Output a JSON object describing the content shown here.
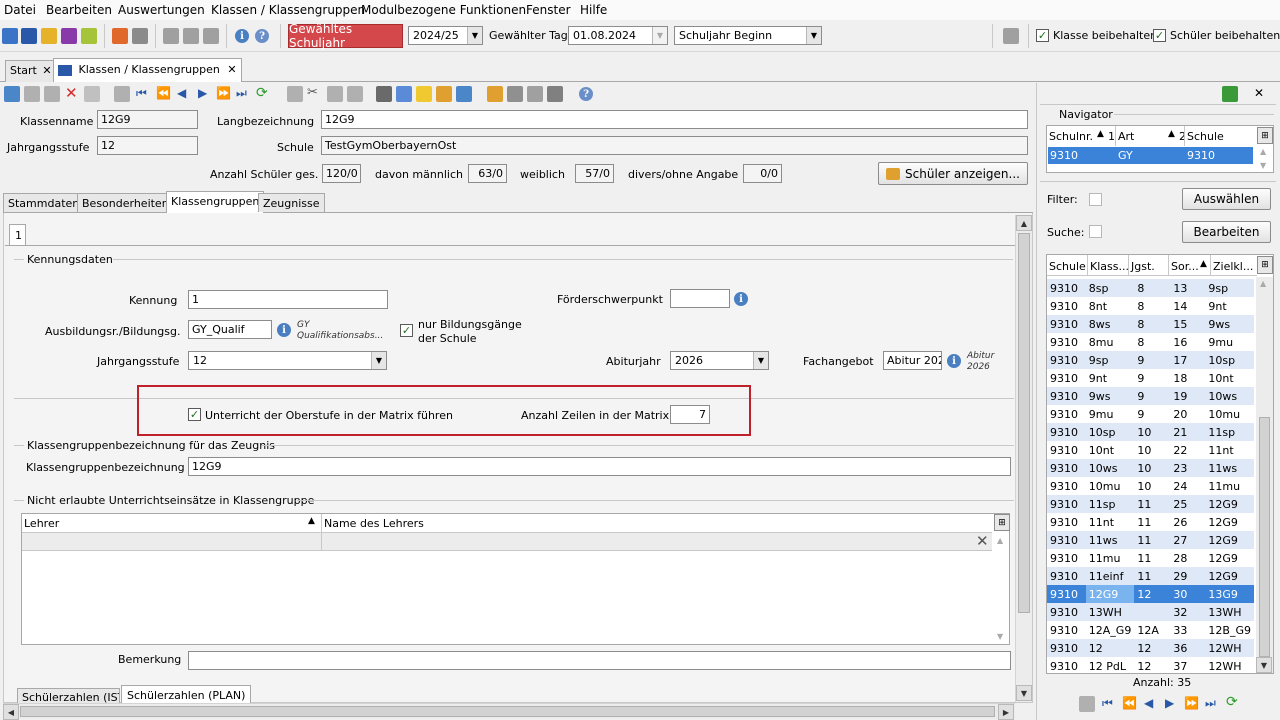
{
  "menu": [
    "Datei",
    "Bearbeiten",
    "Auswertungen",
    "Klassen / Klassengruppen",
    "Modulbezogene Funktionen",
    "Fenster",
    "Hilfe"
  ],
  "toolbar": {
    "schuljahr_button": "Gewähltes Schuljahr",
    "schuljahr_value": "2024/25",
    "tag_label": "Gewählter Tag",
    "tag_value": "01.08.2024",
    "period_value": "Schuljahr Beginn",
    "klasse_beibehalten": "Klasse beibehalten",
    "schueler_beibehalten": "Schüler beibehalten"
  },
  "doc_tabs": {
    "start": "Start",
    "klassen": "Klassen / Klassengruppen"
  },
  "header": {
    "klassenname_label": "Klassenname",
    "klassenname": "12G9",
    "langbezeichnung_label": "Langbezeichnung",
    "langbezeichnung": "12G9",
    "jahrgangsstufe_label": "Jahrgangsstufe",
    "jahrgangsstufe": "12",
    "schule_label": "Schule",
    "schule": "TestGymOberbayernOst",
    "anzahl_label": "Anzahl Schüler ges.",
    "anzahl": "120/0",
    "maennlich_label": "davon männlich",
    "maennlich": "63/0",
    "weiblich_label": "weiblich",
    "weiblich": "57/0",
    "divers_label": "divers/ohne Angabe",
    "divers": "0/0",
    "schueler_anzeigen": "Schüler anzeigen..."
  },
  "form_tabs": [
    "Stammdaten",
    "Besonderheiten",
    "Klassengruppen",
    "Zeugnisse"
  ],
  "subtab": "1",
  "kennung": {
    "section": "Kennungsdaten",
    "kennung_label": "Kennung",
    "kennung": "1",
    "foerder_label": "Förderschwerpunkt",
    "foerder": "",
    "ausbildung_label": "Ausbildungsr./Bildungsg.",
    "ausbildung": "GY_Qualif",
    "ausbildung_hint_1": "GY",
    "ausbildung_hint_2": "Qualifikationsabs...",
    "nur_bildung_1": "nur Bildungsgänge",
    "nur_bildung_2": "der Schule",
    "jahrgang_label": "Jahrgangsstufe",
    "jahrgang": "12",
    "abitur_label": "Abiturjahr",
    "abitur": "2026",
    "fachangebot_label": "Fachangebot",
    "fachangebot": "Abitur 202",
    "fach_hint_1": "Abitur",
    "fach_hint_2": "2026",
    "matrix_label": "Unterricht der Oberstufe in der Matrix führen",
    "zeilen_label": "Anzahl Zeilen in der Matrix",
    "zeilen": "7"
  },
  "zeugnis": {
    "section": "Klassengruppenbezeichnung für das Zeugnis",
    "label": "Klassengruppenbezeichnung",
    "value": "12G9"
  },
  "nicht_erlaubt": {
    "section": "Nicht erlaubte Unterrichtseinsätze in Klassengruppe",
    "col1": "Lehrer",
    "col2": "Name des Lehrers"
  },
  "bemerkung_label": "Bemerkung",
  "bottom_tabs": [
    "Schülerzahlen (IST)",
    "Schülerzahlen (PLAN)"
  ],
  "navigator": {
    "title": "Navigator",
    "cols": [
      "Schulnr.",
      "Art",
      "Schule"
    ],
    "sort_marks": [
      "1",
      "2"
    ],
    "row": [
      "9310",
      "GY",
      "9310"
    ],
    "filter_label": "Filter:",
    "suche_label": "Suche:",
    "auswaehlen": "Auswählen",
    "bearbeiten": "Bearbeiten",
    "list_cols": [
      "Schule",
      "Klass...",
      "Jgst.",
      "Sor...",
      "Zielkl..."
    ],
    "rows": [
      [
        "9310",
        "8sp",
        "8",
        "13",
        "9sp"
      ],
      [
        "9310",
        "8nt",
        "8",
        "14",
        "9nt"
      ],
      [
        "9310",
        "8ws",
        "8",
        "15",
        "9ws"
      ],
      [
        "9310",
        "8mu",
        "8",
        "16",
        "9mu"
      ],
      [
        "9310",
        "9sp",
        "9",
        "17",
        "10sp"
      ],
      [
        "9310",
        "9nt",
        "9",
        "18",
        "10nt"
      ],
      [
        "9310",
        "9ws",
        "9",
        "19",
        "10ws"
      ],
      [
        "9310",
        "9mu",
        "9",
        "20",
        "10mu"
      ],
      [
        "9310",
        "10sp",
        "10",
        "21",
        "11sp"
      ],
      [
        "9310",
        "10nt",
        "10",
        "22",
        "11nt"
      ],
      [
        "9310",
        "10ws",
        "10",
        "23",
        "11ws"
      ],
      [
        "9310",
        "10mu",
        "10",
        "24",
        "11mu"
      ],
      [
        "9310",
        "11sp",
        "11",
        "25",
        "12G9"
      ],
      [
        "9310",
        "11nt",
        "11",
        "26",
        "12G9"
      ],
      [
        "9310",
        "11ws",
        "11",
        "27",
        "12G9"
      ],
      [
        "9310",
        "11mu",
        "11",
        "28",
        "12G9"
      ],
      [
        "9310",
        "11einf",
        "11",
        "29",
        "12G9"
      ],
      [
        "9310",
        "12G9",
        "12",
        "30",
        "13G9"
      ],
      [
        "9310",
        "13WH",
        "",
        "32",
        "13WH"
      ],
      [
        "9310",
        "12A_G9",
        "12A",
        "33",
        "12B_G9"
      ],
      [
        "9310",
        "12",
        "12",
        "36",
        "12WH"
      ],
      [
        "9310",
        "12 PdL",
        "12",
        "37",
        "12WH"
      ]
    ],
    "selected_index": 17,
    "anzahl": "Anzahl: 35"
  }
}
